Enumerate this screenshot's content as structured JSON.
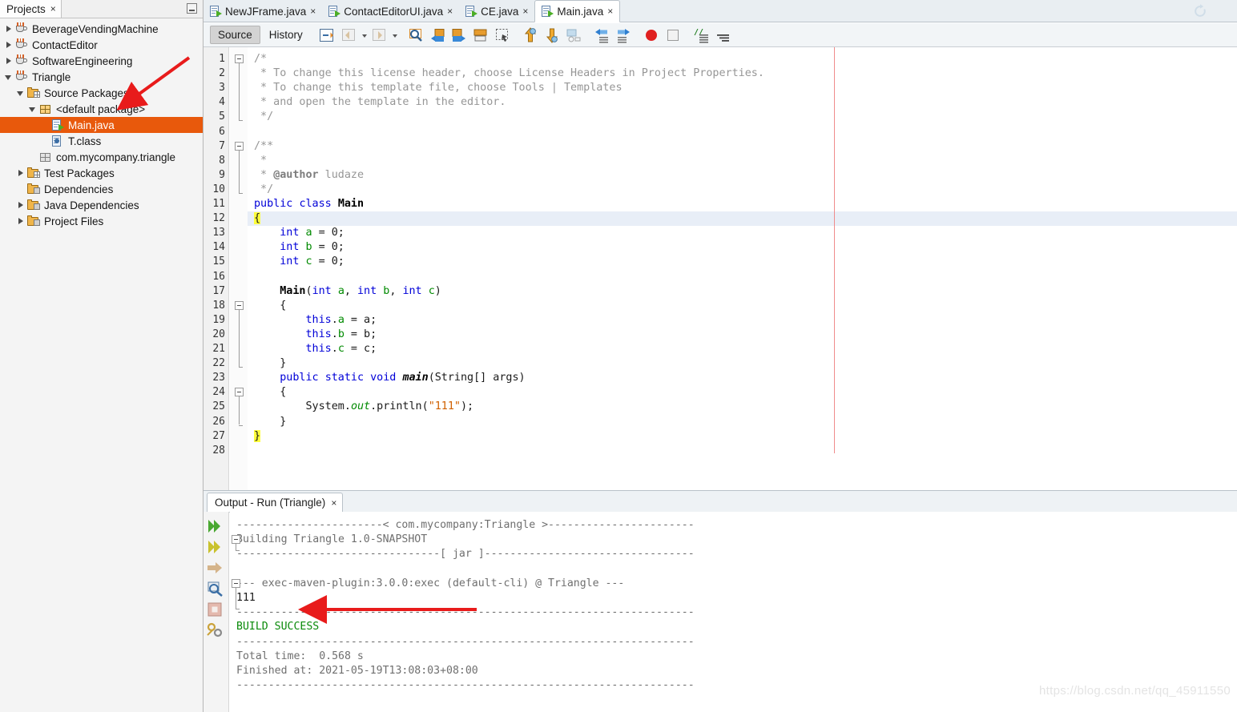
{
  "projects_panel": {
    "tab_label": "Projects",
    "tab_close": "×",
    "tree": [
      {
        "label": "BeverageVendingMachine",
        "icon": "project-icon",
        "indent": 0,
        "twisty": "collapsed"
      },
      {
        "label": "ContactEditor",
        "icon": "project-icon",
        "indent": 0,
        "twisty": "collapsed"
      },
      {
        "label": "SoftwareEngineering",
        "icon": "project-icon",
        "indent": 0,
        "twisty": "collapsed"
      },
      {
        "label": "Triangle",
        "icon": "project-icon",
        "indent": 0,
        "twisty": "expanded"
      },
      {
        "label": "Source Packages",
        "icon": "source-folder-icon",
        "indent": 1,
        "twisty": "expanded"
      },
      {
        "label": "<default package>",
        "icon": "package-icon",
        "indent": 2,
        "twisty": "expanded"
      },
      {
        "label": "Main.java",
        "icon": "java-file-icon",
        "indent": 3,
        "twisty": "none",
        "selected": true
      },
      {
        "label": "T.class",
        "icon": "class-file-icon",
        "indent": 3,
        "twisty": "none"
      },
      {
        "label": "com.mycompany.triangle",
        "icon": "package-grey-icon",
        "indent": 2,
        "twisty": "none"
      },
      {
        "label": "Test Packages",
        "icon": "test-folder-icon",
        "indent": 1,
        "twisty": "collapsed"
      },
      {
        "label": "Dependencies",
        "icon": "dependencies-folder-icon",
        "indent": 1,
        "twisty": "none"
      },
      {
        "label": "Java Dependencies",
        "icon": "java-dependencies-folder-icon",
        "indent": 1,
        "twisty": "collapsed"
      },
      {
        "label": "Project Files",
        "icon": "project-files-folder-icon",
        "indent": 1,
        "twisty": "collapsed"
      }
    ]
  },
  "editor_tabs": [
    {
      "label": "NewJFrame.java",
      "active": false,
      "close": "×"
    },
    {
      "label": "ContactEditorUI.java",
      "active": false,
      "close": "×"
    },
    {
      "label": "CE.java",
      "active": false,
      "close": "×"
    },
    {
      "label": "Main.java",
      "active": true,
      "close": "×"
    }
  ],
  "editor_toolbar": {
    "source_label": "Source",
    "history_label": "History",
    "buttons": [
      "toggle-bookmark-icon",
      "back-icon",
      "forward-icon",
      "find-selection-icon",
      "previous-bookmark-icon",
      "next-bookmark-icon",
      "toggle-rectangular-selection-icon",
      "select-block-icon",
      "previous-error-icon",
      "next-error-icon",
      "shift-line-left-icon",
      "shift-line-right-icon",
      "start-macro-recording-icon",
      "stop-macro-recording-icon",
      "comment-icon",
      "uncomment-icon"
    ]
  },
  "code": {
    "first_line": 1,
    "last_line": 28,
    "lines": [
      "/*",
      " * To change this license header, choose License Headers in Project Properties.",
      " * To change this template file, choose Tools | Templates",
      " * and open the template in the editor.",
      " */",
      "",
      "/**",
      " *",
      " * @author ludaze",
      " */",
      "public class Main",
      "{",
      "    int a = 0;",
      "    int b = 0;",
      "    int c = 0;",
      "",
      "    Main(int a, int b, int c)",
      "    {",
      "        this.a = a;",
      "        this.b = b;",
      "        this.c = c;",
      "    }",
      "    public static void main(String[] args)",
      "    {",
      "        System.out.println(\"111\");",
      "    }",
      "}",
      ""
    ],
    "highlighted_line": 12,
    "matching_braces": [
      "{",
      "}"
    ],
    "author": "ludaze",
    "class_name": "Main",
    "string_literal": "\"111\""
  },
  "output": {
    "tab_label": "Output - Run (Triangle)",
    "tab_close": "×",
    "side_buttons": [
      "rerun-icon",
      "rerun-alt-icon",
      "go-to-source-icon",
      "find-icon",
      "stop-icon",
      "settings-icon"
    ],
    "lines": [
      {
        "text": "-----------------------< com.mycompany:Triangle >-----------------------",
        "style": "normal"
      },
      {
        "text": "Building Triangle 1.0-SNAPSHOT",
        "style": "normal"
      },
      {
        "text": "--------------------------------[ jar ]---------------------------------",
        "style": "normal"
      },
      {
        "text": "",
        "style": "normal"
      },
      {
        "text": "--- exec-maven-plugin:3.0.0:exec (default-cli) @ Triangle ---",
        "style": "normal"
      },
      {
        "text": "111",
        "style": "dark"
      },
      {
        "text": "------------------------------------------------------------------------",
        "style": "normal"
      },
      {
        "text": "BUILD SUCCESS",
        "style": "green"
      },
      {
        "text": "------------------------------------------------------------------------",
        "style": "normal"
      },
      {
        "text": "Total time:  0.568 s",
        "style": "normal"
      },
      {
        "text": "Finished at: 2021-05-19T13:08:03+08:00",
        "style": "normal"
      },
      {
        "text": "------------------------------------------------------------------------",
        "style": "normal"
      }
    ],
    "build_status": "BUILD SUCCESS",
    "total_time": "0.568 s",
    "finished_at": "2021-05-19T13:08:03+08:00",
    "program_output": "111"
  },
  "annotations": {
    "arrow_color": "#e81b1b",
    "tree_arrow_target": "<default package>",
    "output_arrow_target": "111"
  },
  "watermark": "https://blog.csdn.net/qq_45911550",
  "colors": {
    "selection": "#e8590c",
    "keyword": "#0000d8",
    "field": "#008a00",
    "string": "#d06000",
    "comment": "#969696",
    "success": "#0a8a0a"
  }
}
